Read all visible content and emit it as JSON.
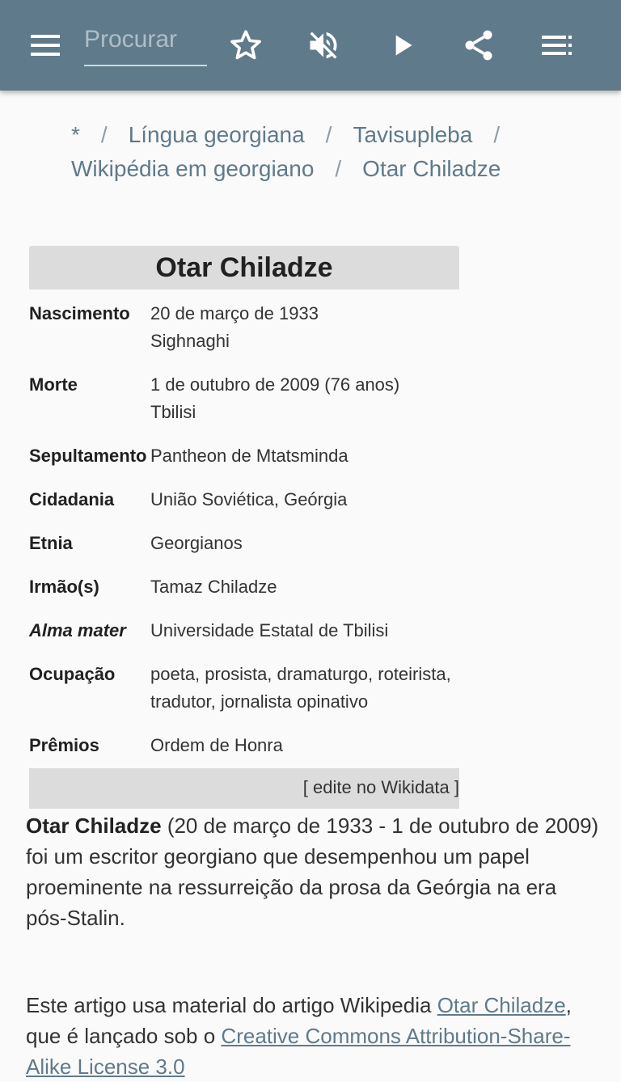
{
  "appbar": {
    "search_placeholder": "Procurar",
    "accent_color": "#5f7a8b"
  },
  "breadcrumb": {
    "items": [
      "*",
      "Língua georgiana",
      "Tavisupleba",
      "Wikipédia em georgiano",
      "Otar Chiladze"
    ],
    "separator": "/"
  },
  "infobox": {
    "title": "Otar Chiladze",
    "rows": [
      {
        "label": "Nascimento",
        "lines": [
          "20 de março de 1933",
          "Sighnaghi"
        ]
      },
      {
        "label": "Morte",
        "lines": [
          "1 de outubro de 2009 (76 anos)",
          "Tbilisi"
        ]
      },
      {
        "label": "Sepultamento",
        "lines": [
          "Pantheon de Mtatsminda"
        ]
      },
      {
        "label": "Cidadania",
        "lines": [
          "União Soviética, Geórgia"
        ]
      },
      {
        "label": "Etnia",
        "lines": [
          "Georgianos"
        ]
      },
      {
        "label": "Irmão(s)",
        "lines": [
          "Tamaz Chiladze"
        ]
      },
      {
        "label": "Alma mater",
        "lines": [
          "Universidade Estatal de Tbilisi"
        ]
      },
      {
        "label": "Ocupação",
        "lines": [
          "poeta, prosista, dramaturgo, roteirista,",
          "tradutor, jornalista opinativo"
        ]
      },
      {
        "label": "Prêmios",
        "lines": [
          "Ordem de Honra"
        ]
      }
    ],
    "footer": "[ edite no Wikidata ]"
  },
  "article": {
    "subject": "Otar Chiladze",
    "text": " (20 de março de 1933 - 1 de outubro de 2009) foi um escritor georgiano que desempenhou um papel proeminente na ressurreição da prosa da Geórgia na era pós-Stalin."
  },
  "attribution": {
    "prefix": "Este artigo usa material do artigo Wikipedia ",
    "link1": "Otar Chiladze",
    "middle": ", que é lançado sob o ",
    "link2": "Creative Commons Attribution-Share-Alike License 3.0"
  }
}
